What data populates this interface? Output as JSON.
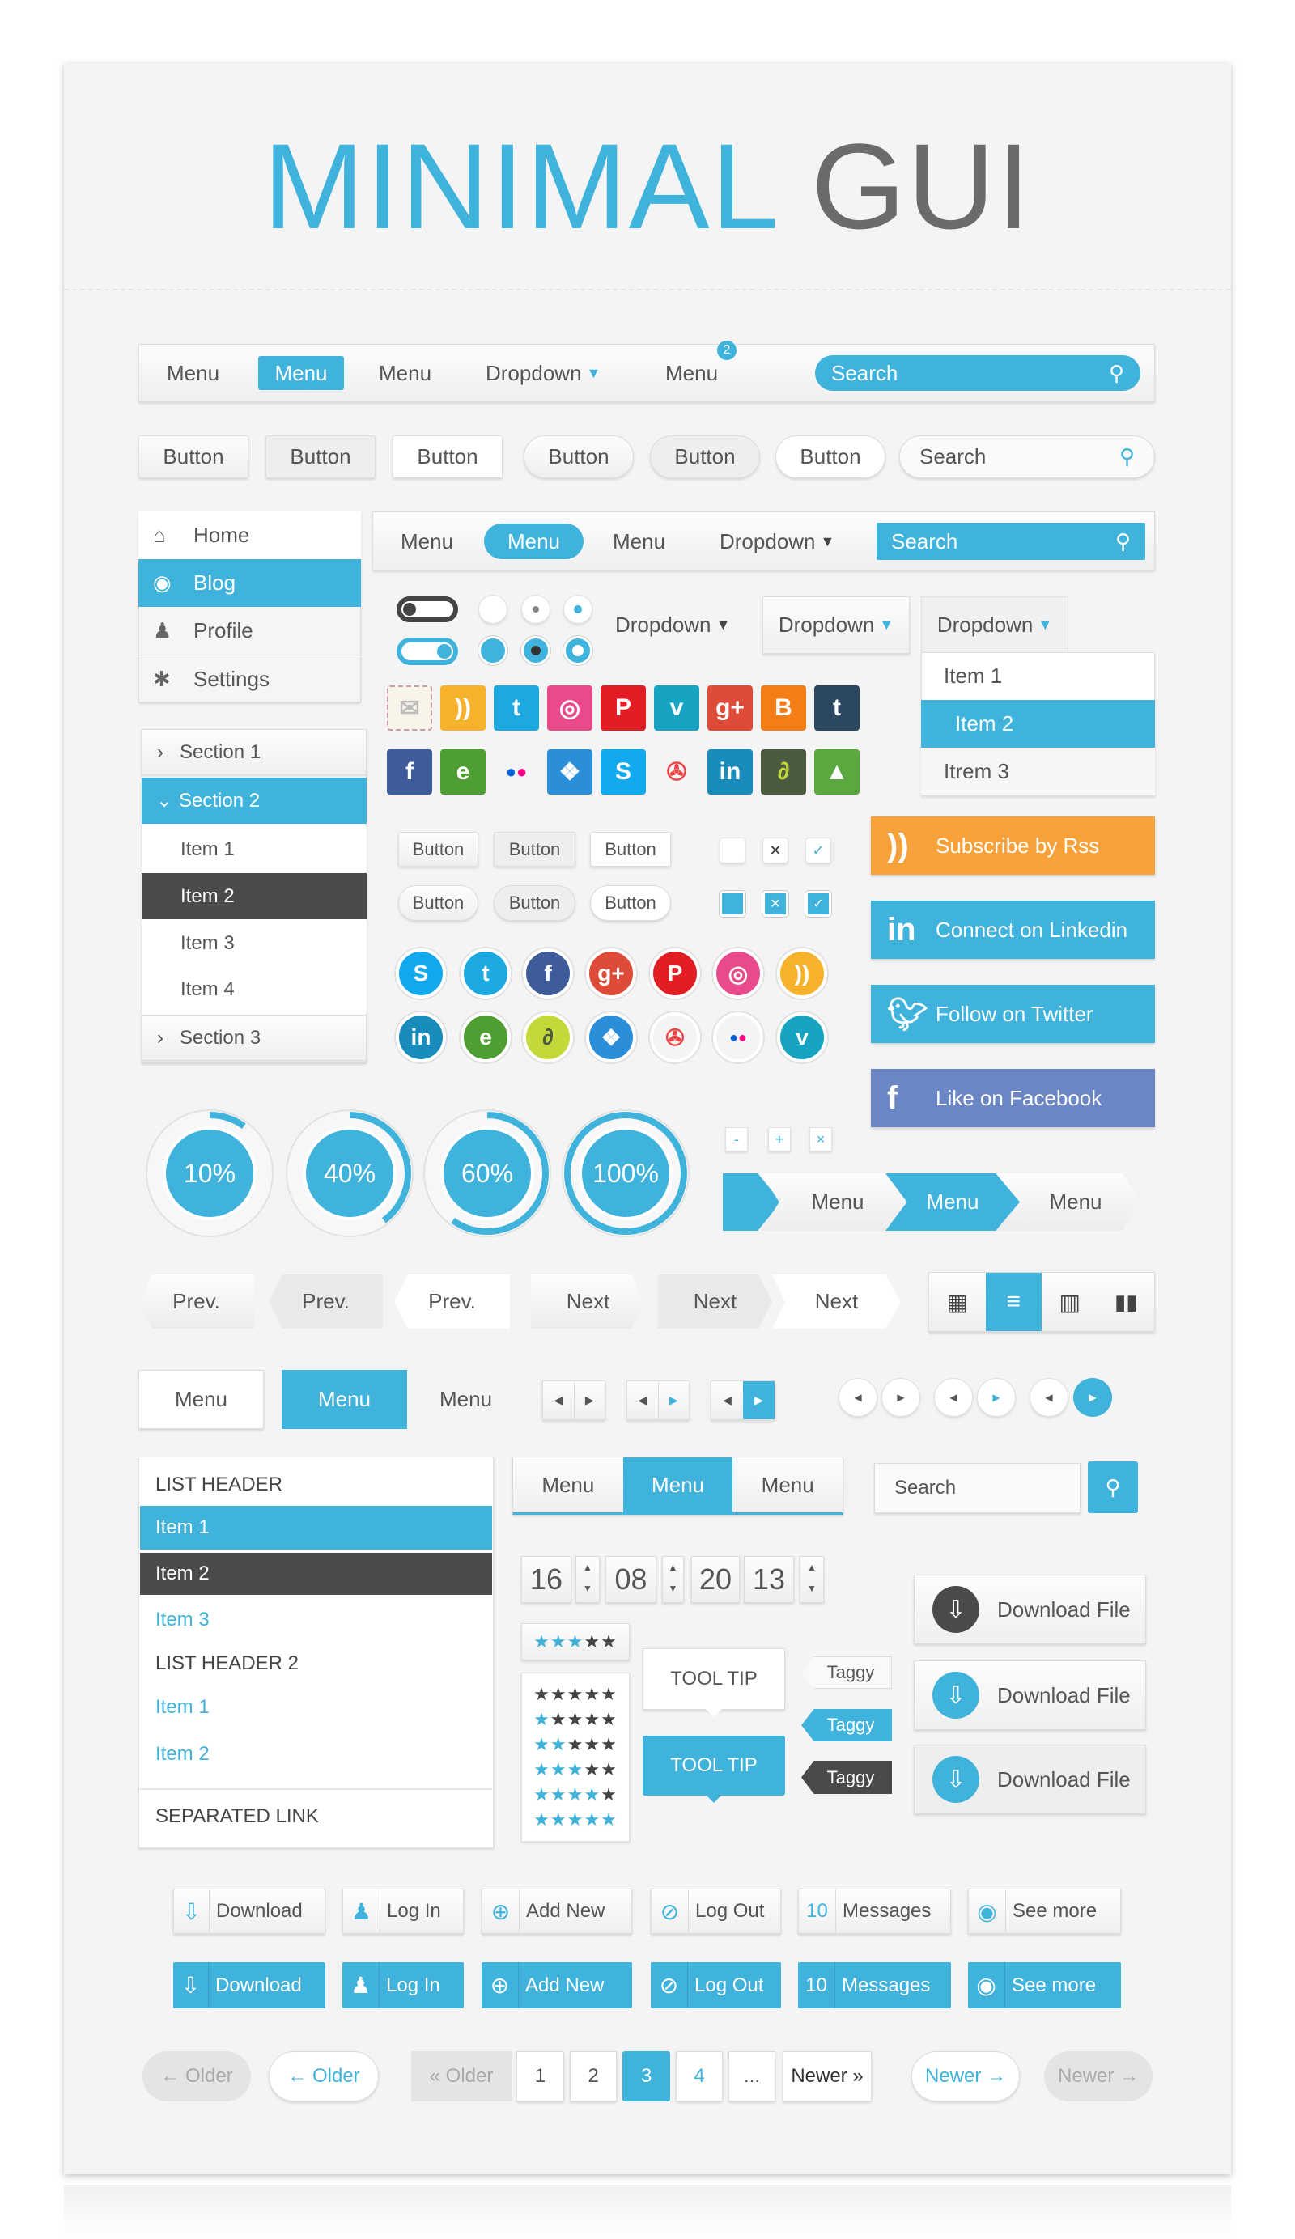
{
  "title": {
    "part1": "MINIMAL",
    "part2": "GUI"
  },
  "colors": {
    "accent": "#3fb3dc",
    "dark": "#4a4a4a",
    "rss": "#f6a13a",
    "linkedin": "#3fb3dc",
    "twitter": "#3fb3dc",
    "facebook": "#6b86c4"
  },
  "nav1": {
    "items": [
      "Menu",
      "Menu",
      "Menu",
      "Dropdown",
      "Menu"
    ],
    "active": 1,
    "badge": "2",
    "search_placeholder": "Search"
  },
  "buttons_row": {
    "buttons": [
      "Button",
      "Button",
      "Button",
      "Button",
      "Button",
      "Button"
    ],
    "search_placeholder": "Search"
  },
  "sidebar": {
    "items": [
      {
        "label": "Home",
        "icon": "home-icon"
      },
      {
        "label": "Blog",
        "icon": "target-icon"
      },
      {
        "label": "Profile",
        "icon": "user-icon"
      },
      {
        "label": "Settings",
        "icon": "gear-icon"
      }
    ],
    "active": 1
  },
  "nav2": {
    "items": [
      "Menu",
      "Menu",
      "Menu",
      "Dropdown"
    ],
    "active": 1,
    "search_placeholder": "Search"
  },
  "toggles": [
    {
      "state": "off"
    },
    {
      "state": "on"
    }
  ],
  "dropdowns": {
    "plain": "Dropdown",
    "boxed": "Dropdown",
    "open": "Dropdown",
    "open_items": [
      "Item 1",
      "Item 2",
      "Itrem 3"
    ],
    "open_active": 1
  },
  "social_squares": {
    "row1": [
      "mail",
      "rss",
      "twitter",
      "dribbble",
      "pinterest",
      "vimeo",
      "google-plus",
      "blogger",
      "tumblr"
    ],
    "row2": [
      "facebook",
      "evernote",
      "flickr",
      "dropbox",
      "skype",
      "picasa",
      "linkedin",
      "deviantart",
      "forrst"
    ]
  },
  "accordion": {
    "sections": [
      "Section 1",
      "Section 2",
      "Section 3"
    ],
    "items": [
      "Item 1",
      "Item 2",
      "Item 3",
      "Item 4"
    ],
    "open_section": 1,
    "active_item": 1
  },
  "small_buttons": {
    "row1": [
      "Button",
      "Button",
      "Button"
    ],
    "row2": [
      "Button",
      "Button",
      "Button"
    ]
  },
  "checkboxes": {
    "row1": [
      "unchecked",
      "x",
      "check"
    ],
    "row2": [
      "filled",
      "x",
      "check"
    ]
  },
  "social_banners": [
    {
      "label": "Subscribe by Rss",
      "icon": "rss-icon"
    },
    {
      "label": "Connect on Linkedin",
      "icon": "linkedin-icon"
    },
    {
      "label": "Follow on Twitter",
      "icon": "twitter-icon"
    },
    {
      "label": "Like on Facebook",
      "icon": "facebook-icon"
    }
  ],
  "social_circles": {
    "row1": [
      "skype",
      "twitter",
      "facebook",
      "google-plus",
      "pinterest",
      "dribbble",
      "rss"
    ],
    "row2": [
      "linkedin",
      "evernote",
      "deviantart",
      "dropbox",
      "picasa",
      "flickr",
      "vimeo"
    ]
  },
  "progress": [
    {
      "label": "10%",
      "value": 10
    },
    {
      "label": "40%",
      "value": 40
    },
    {
      "label": "60%",
      "value": 60
    },
    {
      "label": "100%",
      "value": 100
    }
  ],
  "mini_buttons": [
    "-",
    "+",
    "×"
  ],
  "breadcrumb": [
    "Menu",
    "Menu",
    "Menu"
  ],
  "prev_next": [
    "Prev.",
    "Prev.",
    "Prev.",
    "Next",
    "Next",
    "Next"
  ],
  "view_toggle": {
    "options": [
      "grid-icon",
      "list-icon",
      "columns-icon",
      "barcode-icon"
    ],
    "active": 1
  },
  "menu_tabs": {
    "items": [
      "Menu",
      "Menu",
      "Menu"
    ],
    "active": 1
  },
  "list_group": {
    "header1": "LIST HEADER",
    "items1": [
      "Item 1",
      "Item 2",
      "Item 3"
    ],
    "header2": "LIST HEADER 2",
    "items2": [
      "Item 1",
      "Item 2"
    ],
    "separated": "SEPARATED LINK"
  },
  "segmented": {
    "items": [
      "Menu",
      "Menu",
      "Menu"
    ],
    "active": 1
  },
  "search2": {
    "placeholder": "Search"
  },
  "time": {
    "values": [
      "16",
      "08",
      "20",
      "13"
    ]
  },
  "rating": {
    "value": 3,
    "max": 5,
    "list": [
      0,
      1,
      2,
      3,
      4,
      5
    ]
  },
  "tooltips": [
    "TOOL TIP",
    "TOOL TIP"
  ],
  "tags": [
    "Taggy",
    "Taggy",
    "Taggy"
  ],
  "download_file": [
    "Download File",
    "Download File",
    "Download File"
  ],
  "icon_buttons": [
    {
      "label": "Download",
      "icon": "download-icon"
    },
    {
      "label": "Log In",
      "icon": "user-icon"
    },
    {
      "label": "Add New",
      "icon": "plus-icon"
    },
    {
      "label": "Log Out",
      "icon": "pencil-icon"
    },
    {
      "label": "Messages",
      "count": "10"
    },
    {
      "label": "See more",
      "icon": "eye-icon"
    }
  ],
  "pagination": {
    "older_disabled": "← Older",
    "older": "← Older",
    "older_prev": "« Older",
    "pages": [
      "1",
      "2",
      "3",
      "4",
      "..."
    ],
    "active": "3",
    "newer_next": "Newer »",
    "newer": "Newer →",
    "newer_disabled": "Newer →"
  }
}
